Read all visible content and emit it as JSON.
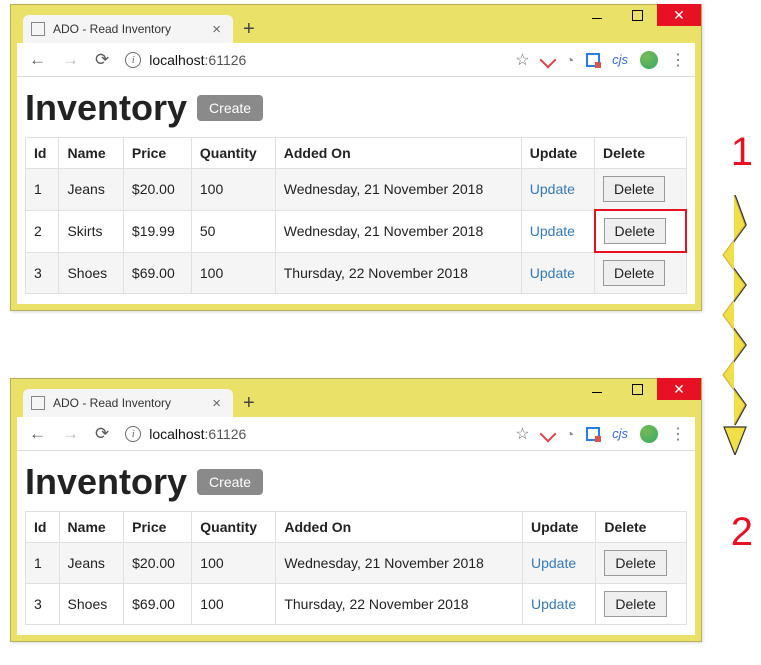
{
  "step_labels": {
    "one": "1",
    "two": "2"
  },
  "browser": {
    "tab_title": "ADO - Read Inventory",
    "url_host": "localhost",
    "url_port": ":61126"
  },
  "page": {
    "title": "Inventory",
    "create_label": "Create",
    "columns": {
      "id": "Id",
      "name": "Name",
      "price": "Price",
      "quantity": "Quantity",
      "added_on": "Added On",
      "update": "Update",
      "delete": "Delete"
    },
    "actions": {
      "update": "Update",
      "delete": "Delete"
    }
  },
  "window1": {
    "rows": [
      {
        "id": "1",
        "name": "Jeans",
        "price": "$20.00",
        "quantity": "100",
        "added_on": "Wednesday, 21 November 2018"
      },
      {
        "id": "2",
        "name": "Skirts",
        "price": "$19.99",
        "quantity": "50",
        "added_on": "Wednesday, 21 November 2018"
      },
      {
        "id": "3",
        "name": "Shoes",
        "price": "$69.00",
        "quantity": "100",
        "added_on": "Thursday, 22 November 2018"
      }
    ]
  },
  "window2": {
    "rows": [
      {
        "id": "1",
        "name": "Jeans",
        "price": "$20.00",
        "quantity": "100",
        "added_on": "Wednesday, 21 November 2018"
      },
      {
        "id": "3",
        "name": "Shoes",
        "price": "$69.00",
        "quantity": "100",
        "added_on": "Thursday, 22 November 2018"
      }
    ]
  }
}
